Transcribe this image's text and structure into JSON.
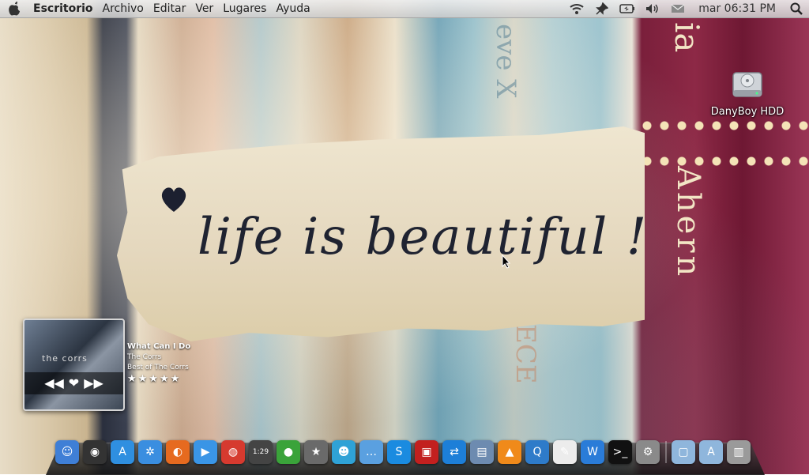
{
  "menubar": {
    "app_name": "Escritorio",
    "menus": [
      "Archivo",
      "Editar",
      "Ver",
      "Lugares",
      "Ayuda"
    ],
    "tray_icons": [
      "wifi-icon",
      "pin-icon",
      "battery-icon",
      "volume-icon",
      "mail-icon"
    ],
    "clock": "mar 06:31 PM"
  },
  "wallpaper": {
    "paper_text": "life is beautiful !",
    "book_text_1": "Ahern",
    "book_text_2": "ia",
    "book_text_3": "eve X",
    "book_text_4": "ECE"
  },
  "desktop": {
    "hdd_label": "DanyBoy HDD"
  },
  "music": {
    "title": "What Can I Do",
    "artist": "The Corrs",
    "album": "Best of The Corrs",
    "rating": 5,
    "cover_text": "the corrs",
    "controls": [
      "◀◀",
      "❤",
      "▶▶"
    ],
    "stars_text": "★★★★★"
  },
  "dock": {
    "icons": [
      {
        "name": "finder-icon",
        "glyph": "☺",
        "color": "#3f7fd6"
      },
      {
        "name": "dashboard-icon",
        "glyph": "◉",
        "color": "#333333"
      },
      {
        "name": "appstore-icon",
        "glyph": "A",
        "color": "#2f8fe0"
      },
      {
        "name": "safari-icon",
        "glyph": "✲",
        "color": "#3a8ee0"
      },
      {
        "name": "firefox-icon",
        "glyph": "◐",
        "color": "#e66a1f"
      },
      {
        "name": "facetime-icon",
        "glyph": "▶",
        "color": "#3a95e6"
      },
      {
        "name": "chrome-icon",
        "glyph": "◍",
        "color": "#d63a2f"
      },
      {
        "name": "calculator-icon",
        "glyph": "1:29",
        "color": "#444444"
      },
      {
        "name": "adium-icon",
        "glyph": "●",
        "color": "#3aa33a"
      },
      {
        "name": "imovie-icon",
        "glyph": "★",
        "color": "#6a6a6a"
      },
      {
        "name": "messenger-icon",
        "glyph": "☻",
        "color": "#2fa2d6"
      },
      {
        "name": "ichat-icon",
        "glyph": "…",
        "color": "#5aa0e0"
      },
      {
        "name": "skype-icon",
        "glyph": "S",
        "color": "#1a8be0"
      },
      {
        "name": "photobooth-icon",
        "glyph": "▣",
        "color": "#c2201f"
      },
      {
        "name": "teamviewer-icon",
        "glyph": "⇄",
        "color": "#1d7fd8"
      },
      {
        "name": "preview-icon",
        "glyph": "▤",
        "color": "#6d8bb0"
      },
      {
        "name": "vlc-icon",
        "glyph": "▲",
        "color": "#f08a1a"
      },
      {
        "name": "quicktime-icon",
        "glyph": "Q",
        "color": "#2e7bc9"
      },
      {
        "name": "textedit-icon",
        "glyph": "✎",
        "color": "#ececec"
      },
      {
        "name": "wunderlist-icon",
        "glyph": "W",
        "color": "#2a7cd8"
      },
      {
        "name": "terminal-icon",
        "glyph": ">_",
        "color": "#111111"
      },
      {
        "name": "system-preferences-icon",
        "glyph": "⚙",
        "color": "#8a8a8a"
      },
      {
        "name": "documents-folder-icon",
        "glyph": "▢",
        "color": "#8fb6dc"
      },
      {
        "name": "applications-folder-icon",
        "glyph": "A",
        "color": "#8fb6dc"
      },
      {
        "name": "trash-icon",
        "glyph": "▥",
        "color": "#9a9a9a"
      }
    ]
  }
}
